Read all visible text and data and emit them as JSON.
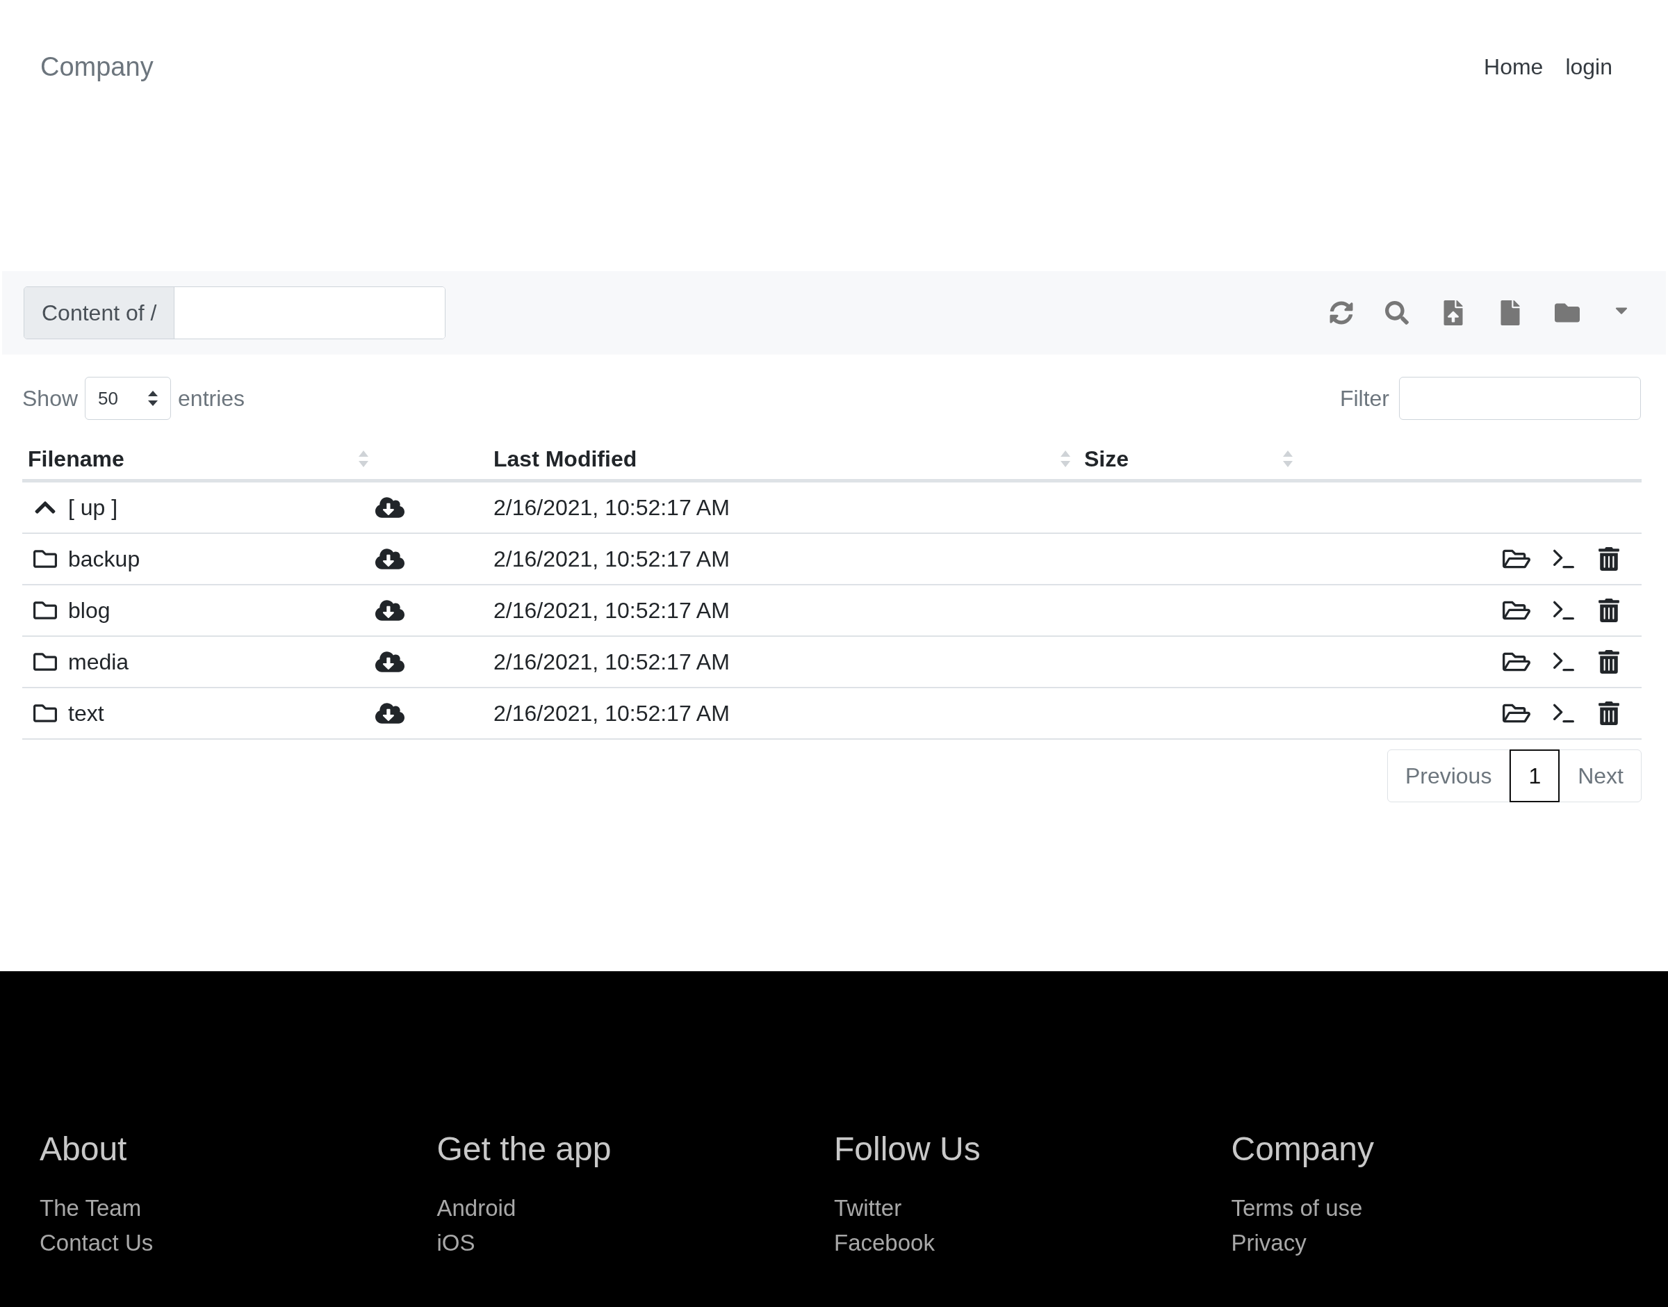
{
  "navbar": {
    "brand": "Company",
    "links": [
      "Home",
      "login"
    ]
  },
  "toolbar": {
    "path_label": "Content of /"
  },
  "length_menu": {
    "label_before": "Show",
    "value": "50",
    "label_after": "entries"
  },
  "filter": {
    "label": "Filter"
  },
  "table": {
    "columns": [
      {
        "label": "Filename",
        "kind": "name"
      },
      {
        "label": "Last Modified",
        "kind": "date"
      },
      {
        "label": "Size",
        "kind": "size"
      }
    ],
    "rows": [
      {
        "kind": "up",
        "name": "[ up ]",
        "modified": "2/16/2021, 10:52:17 AM"
      },
      {
        "kind": "folder",
        "name": "backup",
        "modified": "2/16/2021, 10:52:17 AM"
      },
      {
        "kind": "folder",
        "name": "blog",
        "modified": "2/16/2021, 10:52:17 AM"
      },
      {
        "kind": "folder",
        "name": "media",
        "modified": "2/16/2021, 10:52:17 AM"
      },
      {
        "kind": "folder",
        "name": "text",
        "modified": "2/16/2021, 10:52:17 AM"
      }
    ]
  },
  "pagination": {
    "previous": "Previous",
    "pages": [
      {
        "label": "1",
        "selected": true
      }
    ],
    "next": "Next"
  },
  "footer": [
    {
      "heading": "About",
      "links": [
        "The Team",
        "Contact Us"
      ]
    },
    {
      "heading": "Get the app",
      "links": [
        "Android",
        "iOS"
      ]
    },
    {
      "heading": "Follow Us",
      "links": [
        "Twitter",
        "Facebook"
      ]
    },
    {
      "heading": "Company",
      "links": [
        "Terms of use",
        "Privacy"
      ]
    }
  ]
}
